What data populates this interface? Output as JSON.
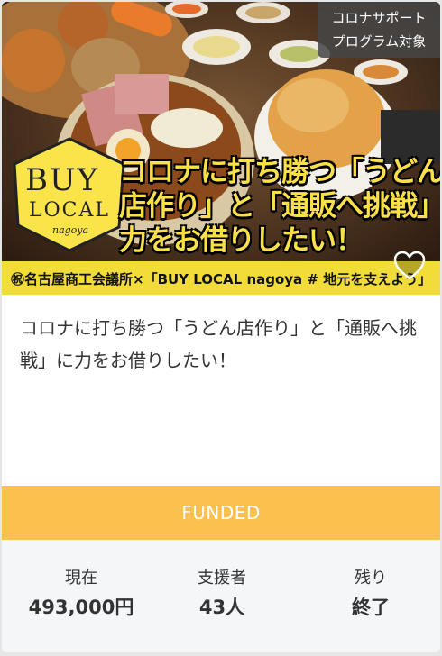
{
  "badge": {
    "line1": "コロナサポート",
    "line2": "プログラム対象"
  },
  "hero": {
    "headline_line1": "コロナに打ち勝つ「うどん",
    "headline_line2": "店作り」と「通販へ挑戦」に",
    "headline_line3": "力をお借りしたい！",
    "logo_word1": "BUY",
    "logo_word2": "LOCAL",
    "logo_word3": "nagoya",
    "strip_text": "㊗名古屋商工会議所×「BUY LOCAL nagoya # 地元を支えよう」"
  },
  "project": {
    "title": "コロナに打ち勝つ「うどん店作り」と「通販へ挑戦」に力をお借りしたい！",
    "status": "FUNDED"
  },
  "stats": {
    "current_label": "現在",
    "current_value": "493,000円",
    "backers_label": "支援者",
    "backers_value": "43人",
    "remaining_label": "残り",
    "remaining_value": "終了"
  },
  "colors": {
    "funded": "#fcc04e",
    "headline": "#fce04a",
    "strip": "#f2dc37"
  },
  "icons": [
    "heart-icon"
  ]
}
